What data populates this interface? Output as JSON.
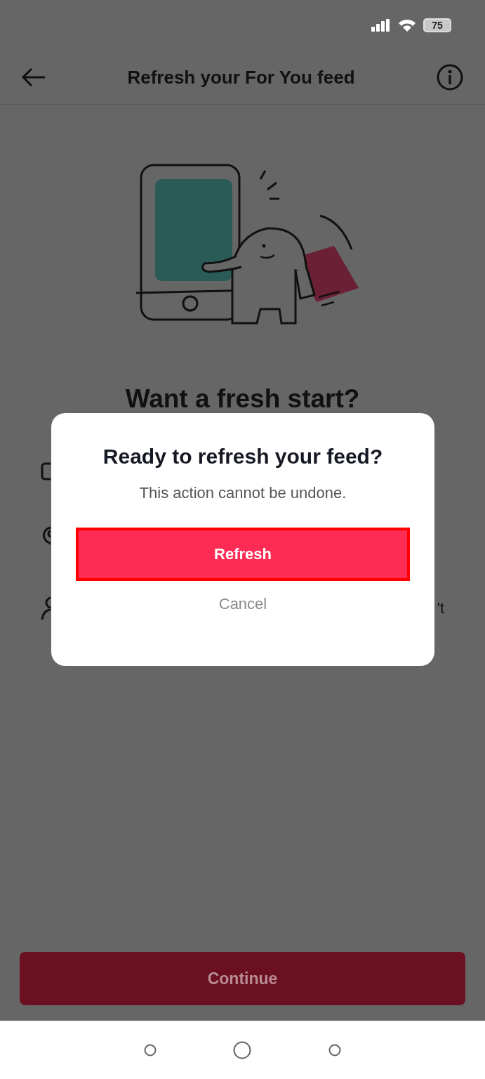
{
  "status_bar": {
    "battery": "75"
  },
  "header": {
    "title": "Refresh your For You feed"
  },
  "heading": "Want a fresh start?",
  "list": {
    "partial_text": "'t"
  },
  "continue_button": {
    "label": "Continue",
    "disabled": true
  },
  "dialog": {
    "title": "Ready to refresh your feed?",
    "message": "This action cannot be undone.",
    "buttons": [
      {
        "label": "Refresh",
        "kind": "primary",
        "highlighted": true
      },
      {
        "label": "Cancel",
        "kind": "secondary",
        "highlighted": false
      }
    ]
  }
}
